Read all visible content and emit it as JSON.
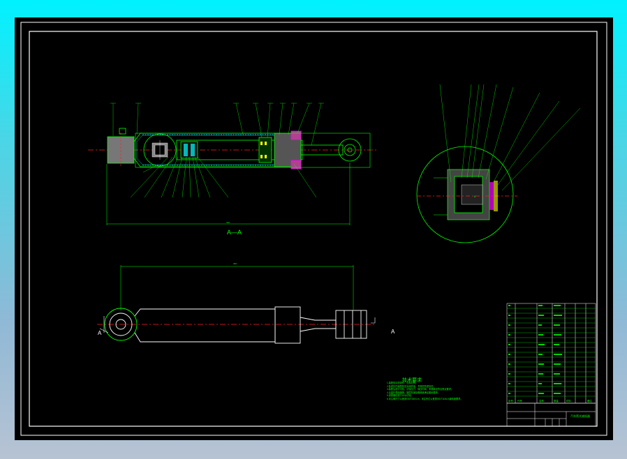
{
  "drawing": {
    "section_label": "A—A",
    "section_marker": "A",
    "dimension_top": "330",
    "dimension_bottom": "360",
    "detail_mark": "8"
  },
  "notes": {
    "title": "技术要求",
    "lines": [
      "1.装配前清洗零件，去除毛刺。",
      "2.各密封件装配前应涂润滑油，不得损伤密封件。",
      "3.装配后进行试验，试验压力、保压时间、泄漏量应符合规定要求。",
      "4.活塞杆表面镀铬，镀层厚度及粗糙度满足图纸要求。",
      "5.减振器应进行示功试验。",
      "6.未注明尺寸公差按GB/T1804-m，未注形位公差按GB/T1184-K级精度要求。"
    ]
  },
  "title_block": {
    "drawing_name": "汽车筒式减振器",
    "headers": [
      "序号",
      "代号",
      "名称",
      "数量",
      "材料",
      "备注"
    ]
  },
  "colors": {
    "background": "#000000",
    "frame": "#ffffff",
    "geometry": "#00ff00",
    "centerline": "#ff2020",
    "seal": "#ffff00",
    "gasket": "#ff00ff",
    "hatch": "#00ffff"
  }
}
